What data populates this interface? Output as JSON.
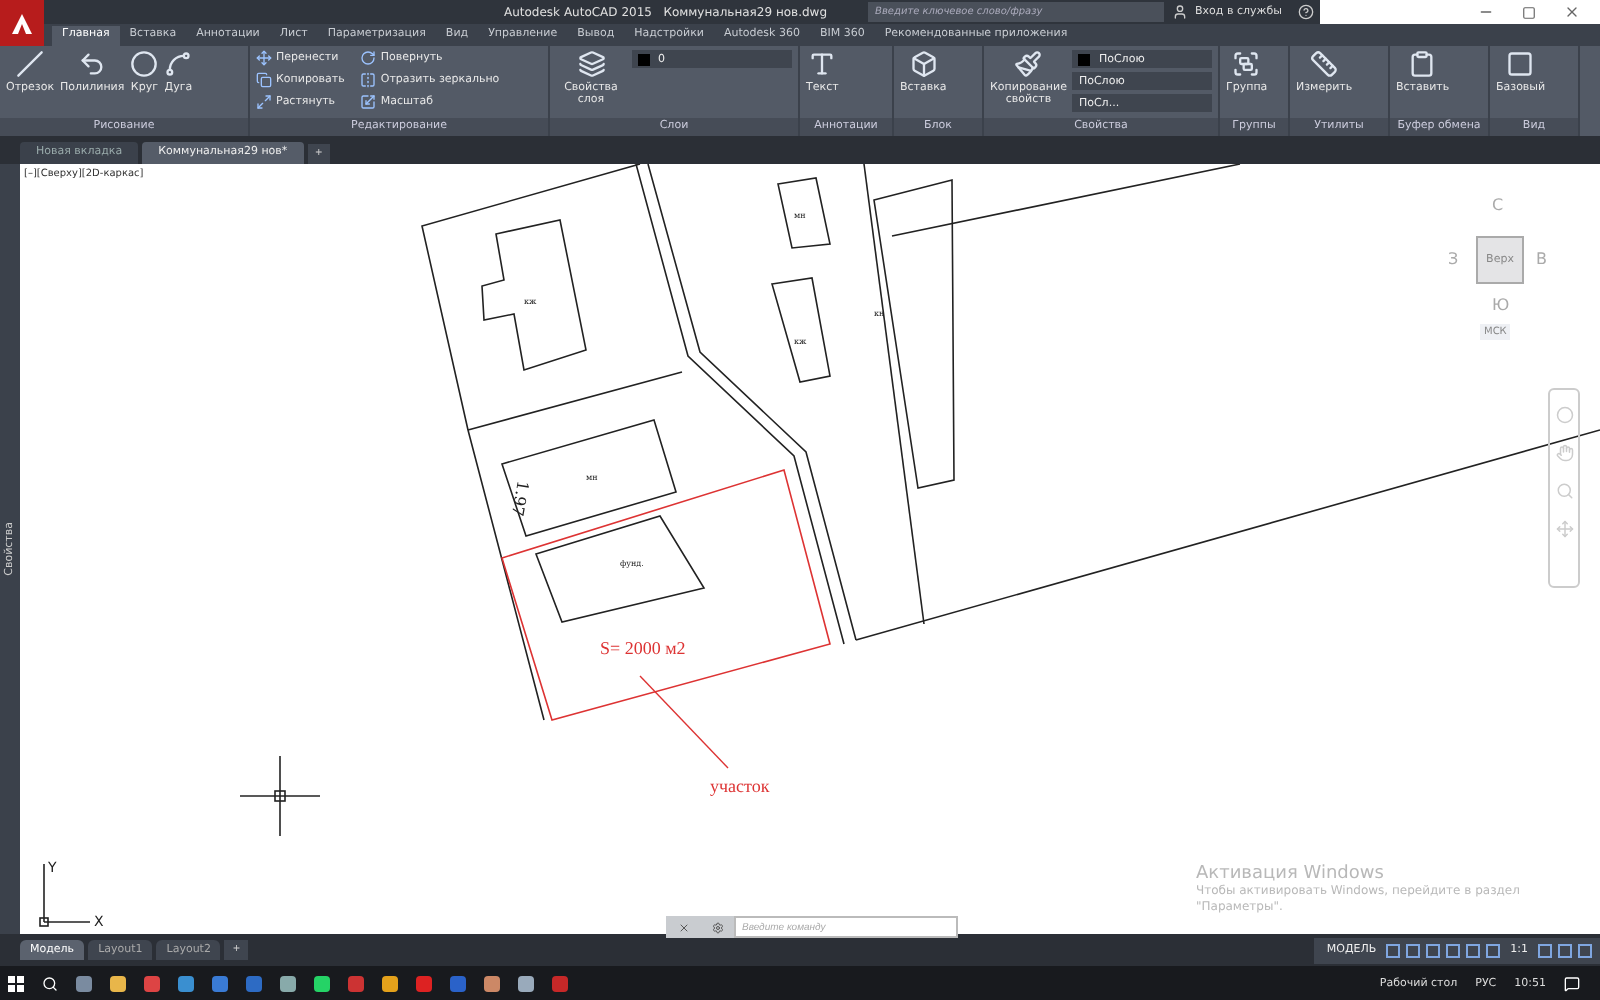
{
  "title_bar": {
    "app_title": "Autodesk AutoCAD 2015",
    "file_name": "Коммунальная29 нов.dwg",
    "search": {
      "placeholder": "Введите ключевое слово/фразу"
    },
    "sign_in": "Вход в службы"
  },
  "ribbon_tabs": [
    {
      "label": "Главная",
      "selected": true
    },
    {
      "label": "Вставка",
      "selected": false
    },
    {
      "label": "Аннотации",
      "selected": false
    },
    {
      "label": "Лист",
      "selected": false
    },
    {
      "label": "Параметризация",
      "selected": false
    },
    {
      "label": "Вид",
      "selected": false
    },
    {
      "label": "Управление",
      "selected": false
    },
    {
      "label": "Вывод",
      "selected": false
    },
    {
      "label": "Надстройки",
      "selected": false
    },
    {
      "label": "Autodesk 360",
      "selected": false
    },
    {
      "label": "BIM 360",
      "selected": false
    },
    {
      "label": "Рекомендованные приложения",
      "selected": false
    }
  ],
  "ribbon_panels": [
    {
      "title": "Рисование",
      "large_tools": [
        "Отрезок",
        "Полилиния",
        "Круг",
        "Дуга"
      ]
    },
    {
      "title": "Редактирование",
      "small_tools": [
        "Перенести",
        "Повернуть",
        "Копировать",
        "Отразить зеркально",
        "Растянуть",
        "Масштаб"
      ]
    },
    {
      "title": "Слои",
      "large_tools": [
        "Свойства слоя"
      ],
      "dropdowns": [
        "0"
      ]
    },
    {
      "title": "Аннотации",
      "large_tools": [
        "Текст"
      ]
    },
    {
      "title": "Блок",
      "large_tools": [
        "Вставка"
      ]
    },
    {
      "title": "Свойства",
      "large_tools": [
        "Копирование свойств"
      ],
      "dropdowns": [
        "ПоСлою",
        "ПоСлою",
        "ПоСл..."
      ]
    },
    {
      "title": "Группы",
      "large_tools": [
        "Группа"
      ]
    },
    {
      "title": "Утилиты",
      "large_tools": [
        "Измерить"
      ]
    },
    {
      "title": "Буфер обмена",
      "large_tools": [
        "Вставить"
      ]
    },
    {
      "title": "Вид",
      "large_tools": [
        "Базовый"
      ]
    }
  ],
  "document_tabs": [
    {
      "label": "Новая вкладка",
      "selected": false
    },
    {
      "label": "Коммунальная29 нов*",
      "selected": true
    }
  ],
  "new_tab_button": "+",
  "side_palette": "Свойства",
  "viewport_label": "[–][Сверху][2D-каркас]",
  "drawing": {
    "labels": [
      "кж",
      "мн",
      "кж",
      "кн",
      "мн",
      "фунд.",
      "1.97"
    ],
    "area_label": "S= 2000 м2",
    "leader_label": "участок"
  },
  "ucs": {
    "x": "X",
    "y": "Y"
  },
  "view_cube": {
    "north": "С",
    "west": "З",
    "east": "В",
    "south": "Ю",
    "face": "Верх",
    "ucs_menu": "МСК"
  },
  "command_line": {
    "placeholder": "Введите команду"
  },
  "activation": {
    "title": "Активация Windows",
    "body": "Чтобы активировать Windows, перейдите в раздел \"Параметры\"."
  },
  "layout_tabs": [
    {
      "label": "Модель",
      "selected": true
    },
    {
      "label": "Layout1",
      "selected": false
    },
    {
      "label": "Layout2",
      "selected": false
    }
  ],
  "new_layout_button": "+",
  "status_bar": {
    "space": "МОДЕЛЬ",
    "scale": "1:1"
  },
  "taskbar": {
    "desktop": "Рабочий стол",
    "language": "РУС",
    "time": "10:51"
  }
}
